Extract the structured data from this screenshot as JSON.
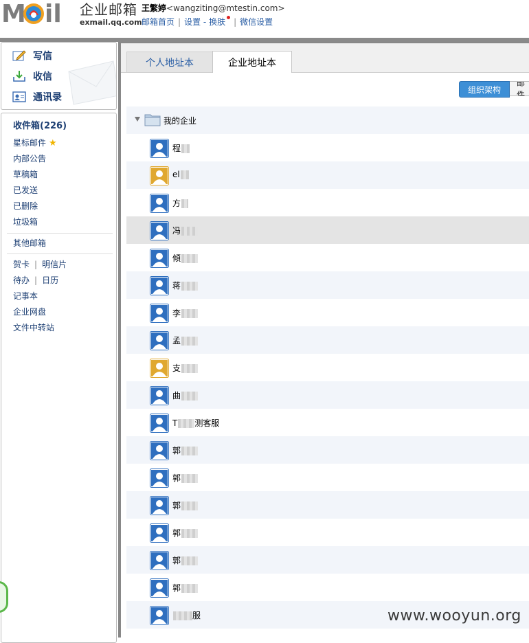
{
  "header": {
    "logo_letters": "MOil",
    "product_title": "企业邮箱",
    "product_domain": "exmail.qq.com",
    "user_name": "王繁婷",
    "user_email": "<wangziting@mtestin.com>",
    "links": {
      "home": "邮箱首页",
      "settings": "设置",
      "dash": "-",
      "skin": "换肤",
      "wechat": "微信设置"
    }
  },
  "actions": {
    "compose": "写信",
    "receive": "收信",
    "contacts": "通讯录"
  },
  "nav": {
    "inbox": "收件箱(226)",
    "starred": "星标邮件",
    "announcements": "内部公告",
    "drafts": "草稿箱",
    "sent": "已发送",
    "deleted": "已删除",
    "spam": "垃圾箱",
    "other_mailboxes": "其他邮箱",
    "greeting_card": "贺卡",
    "postcard": "明信片",
    "todo": "待办",
    "calendar": "日历",
    "notebook": "记事本",
    "netdisk": "企业网盘",
    "file_transfer": "文件中转站"
  },
  "tabs": {
    "personal": "个人地址本",
    "enterprise": "企业地址本"
  },
  "view_toggle": {
    "org": "组织架构",
    "mail": "邮件"
  },
  "tree": {
    "root_label": "我的企业",
    "members": [
      {
        "name": "程",
        "avatar": "blue"
      },
      {
        "name": "el",
        "avatar": "gold"
      },
      {
        "name": "方",
        "avatar": "blue"
      },
      {
        "name": "冯",
        "avatar": "blue"
      },
      {
        "name": "傾",
        "avatar": "blue"
      },
      {
        "name": "蒋",
        "avatar": "blue"
      },
      {
        "name": "李",
        "avatar": "blue"
      },
      {
        "name": "孟",
        "avatar": "blue"
      },
      {
        "name": "支",
        "avatar": "gold"
      },
      {
        "name": "曲",
        "avatar": "blue"
      },
      {
        "name": "T",
        "suffix": "测客服",
        "avatar": "blue"
      },
      {
        "name": "郭",
        "avatar": "blue"
      },
      {
        "name": "郭",
        "avatar": "blue"
      },
      {
        "name": "郭",
        "avatar": "blue"
      },
      {
        "name": "郭",
        "avatar": "blue"
      },
      {
        "name": "郭",
        "avatar": "blue"
      },
      {
        "name": "郭",
        "avatar": "blue"
      },
      {
        "name": "",
        "suffix": "服",
        "avatar": "blue"
      }
    ]
  },
  "colors": {
    "link_blue": "#2a5ea5",
    "toggle_blue": "#3d8fd6",
    "row_alt": "#f2f5fa",
    "row_hover": "#e4e4e4",
    "avatar_blue": "#2f6fbf",
    "avatar_gold": "#e0a830"
  },
  "watermark": "www.wooyun.org"
}
